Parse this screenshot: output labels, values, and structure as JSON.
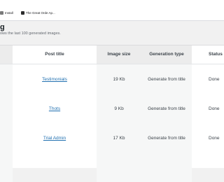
{
  "bookmarks": [
    {
      "label": "Install",
      "icon": "bookmark-icon"
    },
    {
      "label": "The Great Orde Ap...",
      "icon": "site-favicon-icon"
    }
  ],
  "bookmarks_more": "",
  "panel": {
    "title": "g",
    "description": "ows the last 100 generated images."
  },
  "table": {
    "headers": {
      "post_title": "Post title",
      "image_size": "Image size",
      "generation_type": "Generation type",
      "status": "Status"
    },
    "rows": [
      {
        "post_title": "Testimonials",
        "image_size": "19 Kb",
        "generation_type": "Generate from title",
        "status": "Done"
      },
      {
        "post_title": "Thots",
        "image_size": "9 Kb",
        "generation_type": "Generate from title",
        "status": "Done"
      },
      {
        "post_title": "Trial Admin",
        "image_size": "17 Kb",
        "generation_type": "Generate from title",
        "status": "Done"
      }
    ]
  },
  "colors": {
    "link": "#2271b1",
    "page_bg": "#f1f1f1",
    "table_bg": "#ffffff"
  }
}
